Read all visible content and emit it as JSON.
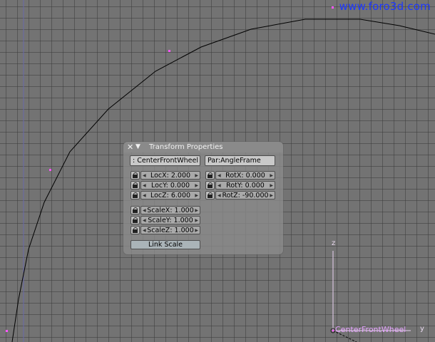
{
  "watermark": "www.foro3d.com",
  "viewport": {
    "axis_z_label": "z",
    "axis_y_label": "y",
    "object_name": "CenterFrontWheel"
  },
  "panel": {
    "title": "Transform Properties",
    "close_icon": "x-icon",
    "collapse_icon": "triangle-down-icon",
    "object_field": ": CenterFrontWheel",
    "parent_field": "Par:AngleFrame",
    "loc": [
      "LocX: 2.000",
      "LocY: 0.000",
      "LocZ: 6.000"
    ],
    "rot": [
      "RotX: 0.000",
      "RotY: 0.000",
      "RotZ: -90.000"
    ],
    "scale": [
      "ScaleX: 1.000",
      "ScaleY: 1.000",
      "ScaleZ: 1.000"
    ],
    "link_scale_label": "Link Scale"
  },
  "colors": {
    "viewport_bg": "#737373",
    "watermark": "#1d38ff",
    "object_name": "#e6a4ff",
    "curve": "#000000"
  }
}
